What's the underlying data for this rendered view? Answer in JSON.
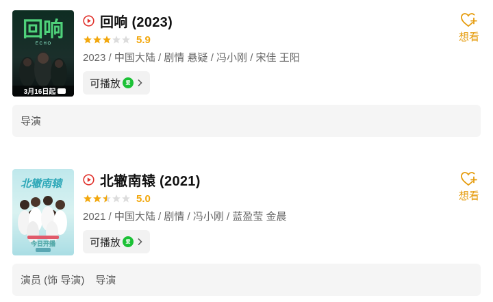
{
  "results": [
    {
      "title": "回响 (2023)",
      "rating": 3,
      "rating_max": 5,
      "score": "5.9",
      "meta": "2023 / 中国大陆 / 剧情 悬疑 / 冯小刚 / 宋佳 王阳",
      "play_label": "可播放",
      "platform_icon": "iqiyi-icon",
      "wish_label": "想看",
      "roles": [
        "导演"
      ],
      "poster": {
        "big_text": "回响",
        "sub_text": "E C H O",
        "date_text": "3月16日起"
      }
    },
    {
      "title": "北辙南辕 (2021)",
      "rating": 2.5,
      "rating_max": 5,
      "score": "5.0",
      "meta": "2021 / 中国大陆 / 剧情 / 冯小刚 / 蓝盈莹 金晨",
      "play_label": "可播放",
      "platform_icon": "iqiyi-icon",
      "wish_label": "想看",
      "roles": [
        "演员 (饰 导演)",
        "导演"
      ],
      "poster": {
        "big_text": "北辙南辕",
        "sub_text": "今日开播"
      }
    }
  ],
  "colors": {
    "accent": "#f2a70c",
    "play_red": "#e0302a",
    "platform_green": "#1cc136",
    "wish": "#e59b0b"
  }
}
